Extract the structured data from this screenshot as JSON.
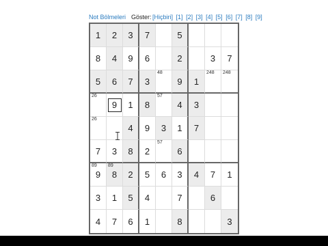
{
  "toolbar": {
    "notes_link": "Not Bölmeleri",
    "show_label": "Göster:",
    "show_options": [
      "[Hiçbiri]",
      "[1]",
      "[2]",
      "[3]",
      "[4]",
      "[5]",
      "[6]",
      "[7]",
      "[8]",
      "[9]"
    ]
  },
  "board": {
    "values": [
      [
        "1",
        "2",
        "3",
        "7",
        "",
        "5",
        "",
        "",
        ""
      ],
      [
        "8",
        "4",
        "9",
        "6",
        "",
        "2",
        "",
        "3",
        "7"
      ],
      [
        "5",
        "6",
        "7",
        "3",
        "",
        "9",
        "1",
        "",
        ""
      ],
      [
        "",
        "9",
        "1",
        "8",
        "",
        "4",
        "3",
        "",
        ""
      ],
      [
        "",
        "",
        "4",
        "9",
        "3",
        "1",
        "7",
        "",
        ""
      ],
      [
        "7",
        "3",
        "8",
        "2",
        "",
        "6",
        "",
        "",
        ""
      ],
      [
        "9",
        "8",
        "2",
        "5",
        "6",
        "3",
        "4",
        "7",
        "1"
      ],
      [
        "3",
        "1",
        "5",
        "4",
        "",
        "7",
        "",
        "6",
        ""
      ],
      [
        "4",
        "7",
        "6",
        "1",
        "",
        "8",
        "",
        "",
        "3"
      ]
    ],
    "given": [
      [
        1,
        1,
        1,
        1,
        0,
        1,
        0,
        0,
        0
      ],
      [
        0,
        1,
        0,
        0,
        0,
        1,
        0,
        0,
        0
      ],
      [
        1,
        1,
        1,
        1,
        0,
        1,
        1,
        0,
        0
      ],
      [
        0,
        0,
        0,
        1,
        0,
        1,
        1,
        0,
        0
      ],
      [
        0,
        0,
        1,
        0,
        1,
        0,
        1,
        0,
        0
      ],
      [
        0,
        0,
        1,
        0,
        0,
        1,
        0,
        0,
        0
      ],
      [
        0,
        1,
        1,
        0,
        0,
        0,
        1,
        0,
        0
      ],
      [
        0,
        0,
        1,
        0,
        0,
        0,
        0,
        1,
        0
      ],
      [
        0,
        0,
        0,
        0,
        0,
        1,
        0,
        0,
        1
      ]
    ],
    "notes": [
      [
        "",
        "",
        "",
        "",
        "",
        "",
        "",
        "",
        ""
      ],
      [
        "",
        "",
        "",
        "",
        "",
        "",
        "",
        "",
        ""
      ],
      [
        "",
        "",
        "",
        "",
        "48",
        "",
        "",
        "248",
        "248"
      ],
      [
        "26",
        "",
        "",
        "",
        "57",
        "",
        "",
        "",
        ""
      ],
      [
        "26",
        "",
        "",
        "",
        "",
        "",
        "",
        "",
        ""
      ],
      [
        "",
        "",
        "",
        "",
        "57",
        "",
        "",
        "",
        ""
      ],
      [
        "89",
        "89",
        "",
        "",
        "",
        "",
        "",
        "",
        ""
      ],
      [
        "",
        "",
        "",
        "",
        "",
        "",
        "",
        "",
        ""
      ],
      [
        "",
        "",
        "",
        "",
        "",
        "",
        "",
        "",
        ""
      ]
    ],
    "selected": {
      "row": 3,
      "col": 1
    }
  }
}
